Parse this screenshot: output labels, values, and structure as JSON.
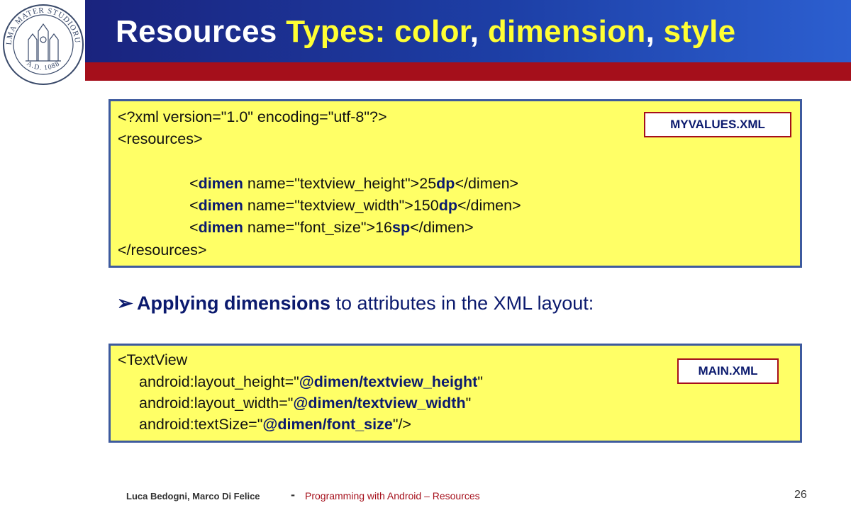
{
  "header": {
    "title_part1": "Resources ",
    "title_part2": "Types: color",
    "title_part3": ", ",
    "title_part4": "dimension",
    "title_part5": ", ",
    "title_part6": "style"
  },
  "logo": {
    "seal_text": "ALMA MATER STUDIORUM",
    "seal_bottom": "A.D. 1088"
  },
  "box1": {
    "label": "MYVALUES.XML",
    "line1": "<?xml version=\"1.0\" encoding=\"utf-8\"?>",
    "line2": "<resources>",
    "dimens": [
      {
        "open": "<",
        "tag": "dimen",
        "attr": " name=\"textview_height\">",
        "num": "25",
        "unit": "dp",
        "close": "</dimen>"
      },
      {
        "open": "<",
        "tag": "dimen",
        "attr": " name=\"textview_width\">",
        "num": "150",
        "unit": "dp",
        "close": "</dimen>"
      },
      {
        "open": "<",
        "tag": "dimen",
        "attr": " name=\"font_size\">",
        "num": "16",
        "unit": "sp",
        "close": "</dimen>"
      }
    ],
    "line_end": "</resources>"
  },
  "bullet": {
    "arrow": "➢",
    "bold": "Applying dimensions",
    "rest": " to attributes in the XML layout:"
  },
  "box2": {
    "label": "MAIN.XML",
    "line1": "<TextView",
    "attrs": [
      {
        "pre": "android:layout_height=\"",
        "val": "@dimen/textview_height",
        "post": "\""
      },
      {
        "pre": "android:layout_width=\"",
        "val": "@dimen/textview_width",
        "post": "\""
      },
      {
        "pre": "android:textSize=\"",
        "val": "@dimen/font_size",
        "post": "\"/>"
      }
    ]
  },
  "footer": {
    "authors": "Luca Bedogni, Marco Di Felice",
    "separator": "-",
    "course": "Programming with Android – Resources",
    "page": "26"
  },
  "colors": {
    "header_blue": "#1d3fa6",
    "header_red": "#a50f1b",
    "title_yellow": "#ffff33",
    "box_yellow": "#ffff66",
    "box_border": "#3d5a9e",
    "text_navy": "#0b1a6e"
  }
}
